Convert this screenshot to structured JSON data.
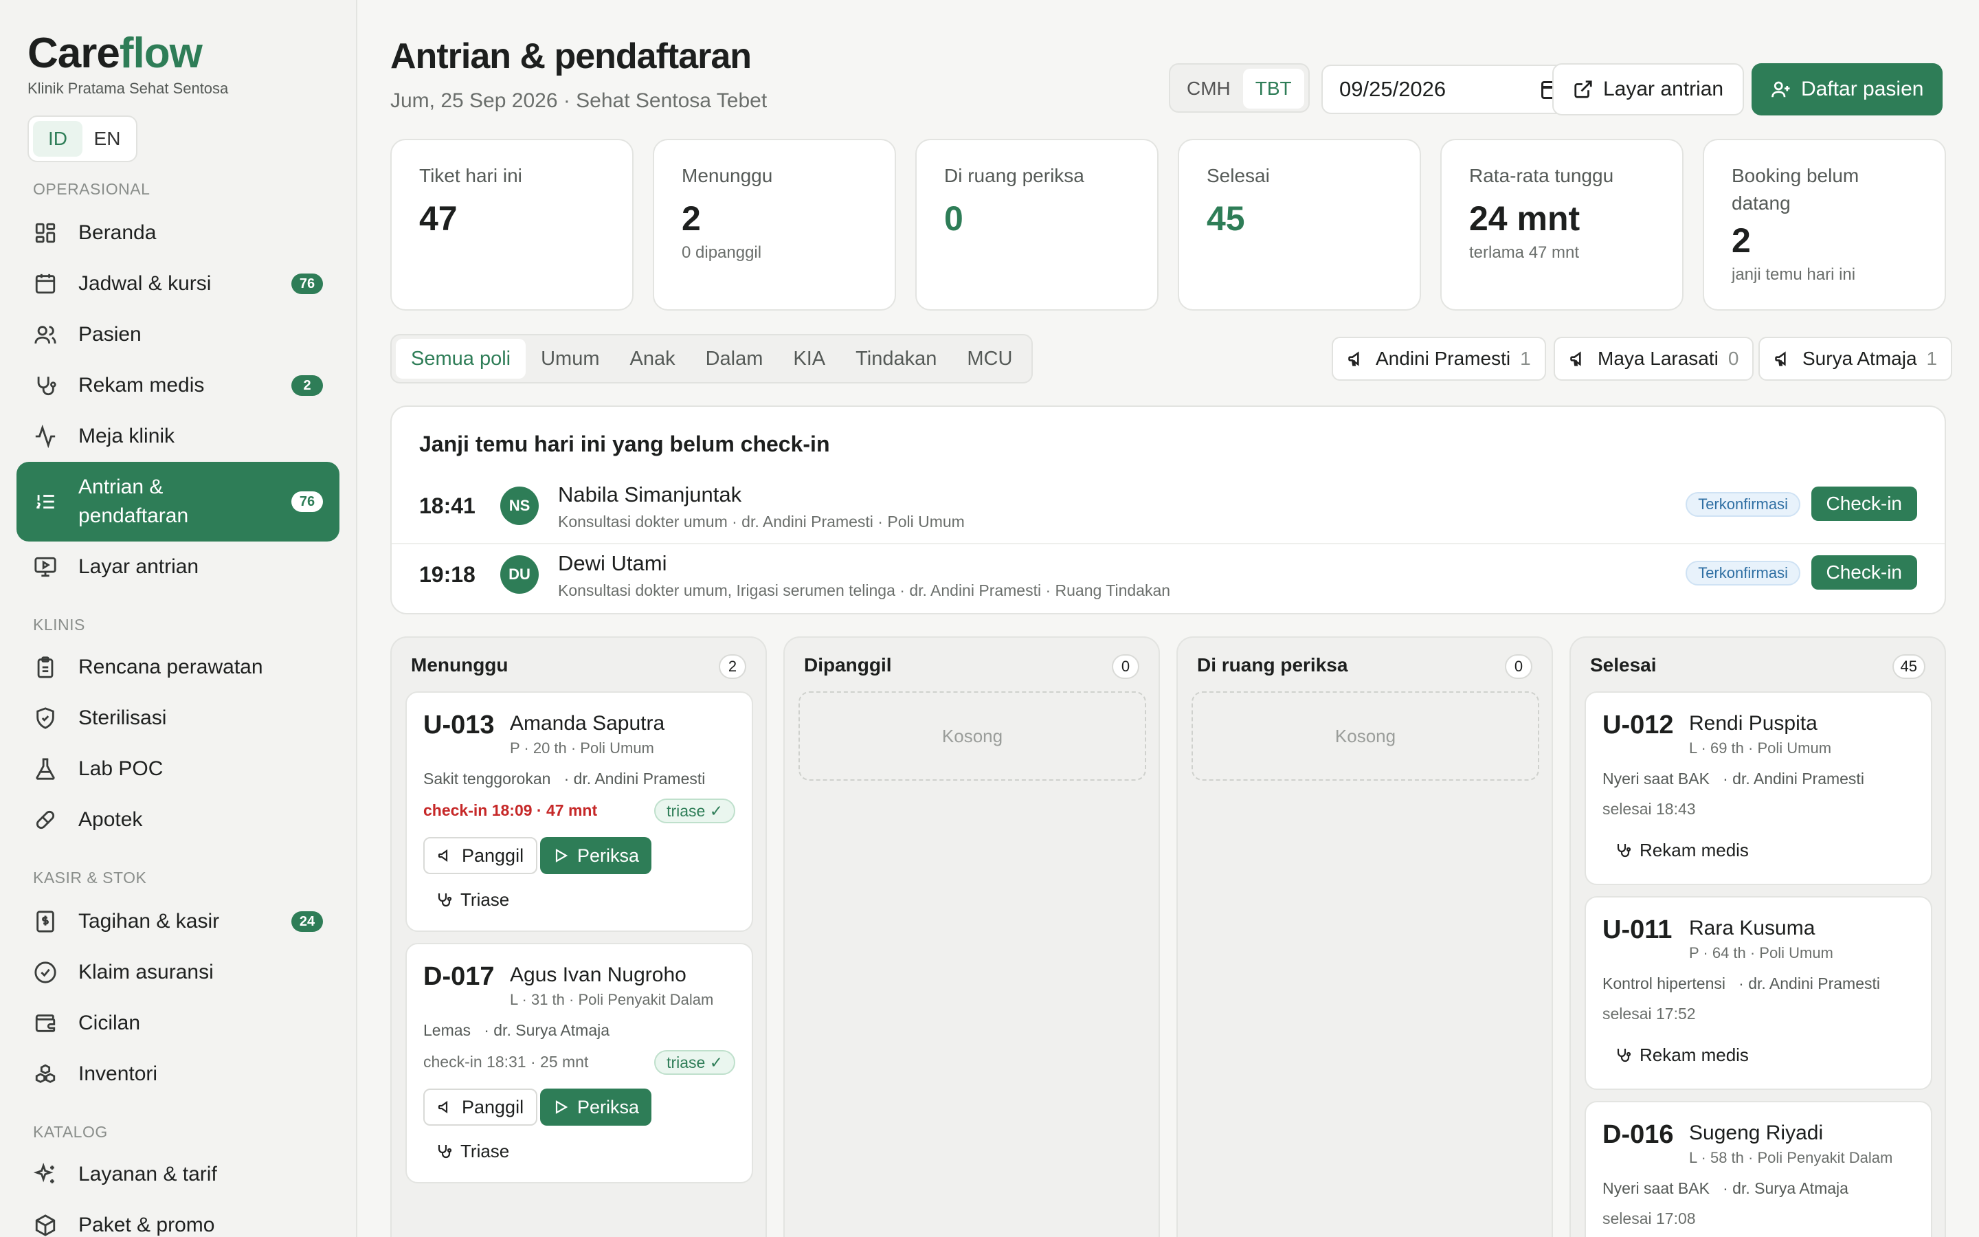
{
  "brand": {
    "care": "Care",
    "flow": "flow",
    "clinic": "Klinik Pratama Sehat Sentosa"
  },
  "lang": {
    "id": "ID",
    "en": "EN"
  },
  "sidebar": {
    "sections": {
      "operasional": "OPERASIONAL",
      "klinis": "KLINIS",
      "kasir": "KASIR & STOK",
      "katalog": "KATALOG"
    },
    "items": [
      {
        "label": "Beranda",
        "icon": "grid-icon"
      },
      {
        "label": "Jadwal & kursi",
        "icon": "calendar-icon",
        "badge": "76"
      },
      {
        "label": "Pasien",
        "icon": "users-icon"
      },
      {
        "label": "Rekam medis",
        "icon": "stethoscope-icon",
        "badge": "2"
      },
      {
        "label": "Meja klinik",
        "icon": "activity-icon"
      },
      {
        "label": "Antrian & pendaftaran",
        "icon": "list-icon",
        "badge": "76"
      },
      {
        "label": "Layar antrian",
        "icon": "monitor-icon"
      },
      {
        "label": "Rencana perawatan",
        "icon": "clipboard-icon"
      },
      {
        "label": "Sterilisasi",
        "icon": "shield-icon"
      },
      {
        "label": "Lab POC",
        "icon": "flask-icon"
      },
      {
        "label": "Apotek",
        "icon": "pill-icon"
      },
      {
        "label": "Tagihan & kasir",
        "icon": "receipt-icon",
        "badge": "24"
      },
      {
        "label": "Klaim asuransi",
        "icon": "check-circle-icon"
      },
      {
        "label": "Cicilan",
        "icon": "wallet-icon"
      },
      {
        "label": "Inventori",
        "icon": "boxes-icon"
      },
      {
        "label": "Layanan & tarif",
        "icon": "sparkles-icon"
      },
      {
        "label": "Paket & promo",
        "icon": "package-icon"
      }
    ]
  },
  "header": {
    "title": "Antrian & pendaftaran",
    "subtitle": "Jum, 25 Sep 2026 · Sehat Sentosa Tebet",
    "branches": [
      "CMH",
      "TBT"
    ],
    "date": "09/25/2026",
    "screen_button": "Layar antrian",
    "register_button": "Daftar pasien"
  },
  "stats": [
    {
      "label": "Tiket hari ini",
      "value": "47",
      "sub": ""
    },
    {
      "label": "Menunggu",
      "value": "2",
      "sub": "0 dipanggil"
    },
    {
      "label": "Di ruang periksa",
      "value": "0",
      "sub": ""
    },
    {
      "label": "Selesai",
      "value": "45",
      "sub": ""
    },
    {
      "label": "Rata-rata tunggu",
      "value": "24 mnt",
      "sub": "terlama 47 mnt"
    },
    {
      "label": "Booking belum datang",
      "value": "2",
      "sub": "janji temu hari ini"
    }
  ],
  "tabs": [
    "Semua poli",
    "Umum",
    "Anak",
    "Dalam",
    "KIA",
    "Tindakan",
    "MCU"
  ],
  "doctors": [
    {
      "name": "Andini Pramesti",
      "count": "1"
    },
    {
      "name": "Maya Larasati",
      "count": "0"
    },
    {
      "name": "Surya Atmaja",
      "count": "1"
    }
  ],
  "appointments": {
    "title": "Janji temu hari ini yang belum check-in",
    "rows": [
      {
        "time": "18:41",
        "initials": "NS",
        "name": "Nabila Simanjuntak",
        "desc": "Konsultasi dokter umum · dr. Andini Pramesti · Poli Umum",
        "status": "Terkonfirmasi",
        "action": "Check-in"
      },
      {
        "time": "19:18",
        "initials": "DU",
        "name": "Dewi Utami",
        "desc": "Konsultasi dokter umum, Irigasi serumen telinga · dr. Andini Pramesti · Ruang Tindakan",
        "status": "Terkonfirmasi",
        "action": "Check-in"
      }
    ]
  },
  "board": {
    "empty": "Kosong",
    "columns": [
      {
        "title": "Menunggu",
        "count": "2"
      },
      {
        "title": "Dipanggil",
        "count": "0"
      },
      {
        "title": "Di ruang periksa",
        "count": "0"
      },
      {
        "title": "Selesai",
        "count": "45"
      }
    ],
    "waiting": [
      {
        "ticket": "U-013",
        "name": "Amanda Saputra",
        "meta": "P · 20 th · Poli Umum",
        "complaint": "Sakit tenggorokan",
        "doctor": "· dr. Andini Pramesti",
        "checkin": "check-in 18:09 · 47 mnt",
        "triage": "triase ✓"
      },
      {
        "ticket": "D-017",
        "name": "Agus Ivan Nugroho",
        "meta": "L · 31 th · Poli Penyakit Dalam",
        "complaint": "Lemas",
        "doctor": "· dr. Surya Atmaja",
        "checkin": "check-in 18:31 · 25 mnt",
        "triage": "triase ✓"
      }
    ],
    "done": [
      {
        "ticket": "U-012",
        "name": "Rendi Puspita",
        "meta": "L · 69 th · Poli Umum",
        "complaint": "Nyeri saat BAK",
        "doctor": "· dr. Andini Pramesti",
        "finished": "selesai 18:43"
      },
      {
        "ticket": "U-011",
        "name": "Rara Kusuma",
        "meta": "P · 64 th · Poli Umum",
        "complaint": "Kontrol hipertensi",
        "doctor": "· dr. Andini Pramesti",
        "finished": "selesai 17:52"
      },
      {
        "ticket": "D-016",
        "name": "Sugeng Riyadi",
        "meta": "L · 58 th · Poli Penyakit Dalam",
        "complaint": "Nyeri saat BAK",
        "doctor": "· dr. Surya Atmaja",
        "finished": "selesai 17:08"
      }
    ],
    "labels": {
      "call": "Panggil",
      "examine": "Periksa",
      "triage": "Triase",
      "record": "Rekam medis"
    }
  }
}
